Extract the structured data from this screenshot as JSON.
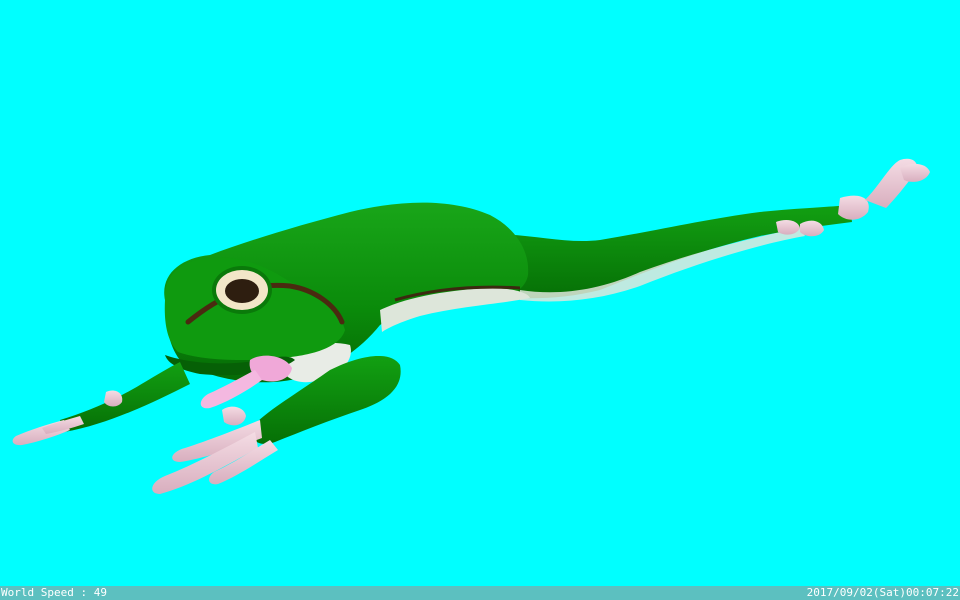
{
  "status_bar": {
    "world_speed_label": "World Speed : 49",
    "datetime": "2017/09/02(Sat)00:07:22"
  },
  "scene": {
    "background_color": "#00ffff",
    "subject": "frog-model",
    "colors": {
      "skin_green": "#0a8a0a",
      "skin_dark_green": "#056005",
      "belly_white": "#e8ece6",
      "toe_pink": "#e6c4d0",
      "tongue_pink": "#f0a8d8",
      "stripe_brown": "#4a2a10",
      "eye_ring": "#f2e6c8",
      "pupil": "#2e1e10"
    }
  }
}
